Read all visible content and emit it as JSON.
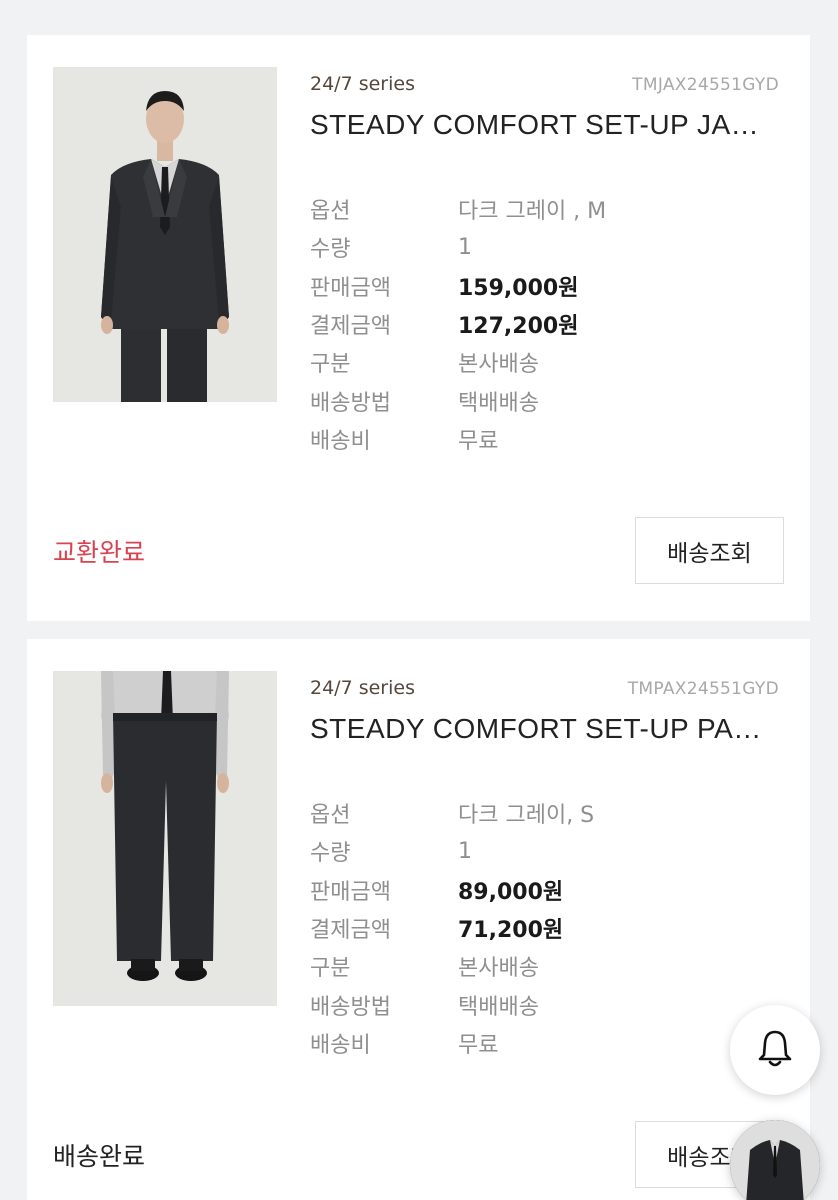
{
  "orders": [
    {
      "series": "24/7 series",
      "code": "TMJAX24551GYD",
      "name": "STEADY COMFORT SET-UP JA…",
      "labels": {
        "option": "옵션",
        "qty": "수량",
        "price": "판매금액",
        "paid": "결제금액",
        "type": "구분",
        "method": "배송방법",
        "fee": "배송비"
      },
      "option": "다크 그레이 , M",
      "qty": "1",
      "price": "159,000원",
      "paid": "127,200원",
      "type": "본사배송",
      "method": "택배배송",
      "fee": "무료",
      "status": "교환완료",
      "status_color": "#d8434f",
      "button": "배송조회",
      "image": "jacket-model-photo"
    },
    {
      "series": "24/7 series",
      "code": "TMPAX24551GYD",
      "name": "STEADY COMFORT SET-UP PA…",
      "labels": {
        "option": "옵션",
        "qty": "수량",
        "price": "판매금액",
        "paid": "결제금액",
        "type": "구분",
        "method": "배송방법",
        "fee": "배송비"
      },
      "option": "다크 그레이, S",
      "qty": "1",
      "price": "89,000원",
      "paid": "71,200원",
      "type": "본사배송",
      "method": "택배배송",
      "fee": "무료",
      "status": "배송완료",
      "status_color": "#222222",
      "button": "배송조회",
      "image": "pants-model-photo"
    }
  ],
  "fab": {
    "bell": "bell-icon",
    "recent": "recent-product-thumbnail"
  }
}
